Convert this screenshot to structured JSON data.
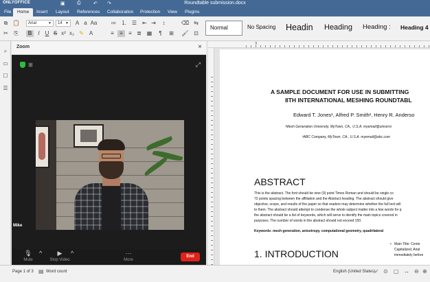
{
  "titlebar": {
    "app_name": "ONLYOFFICE",
    "document_title": "Roundtable submission.docx"
  },
  "menu": {
    "tabs": [
      "File",
      "Home",
      "Insert",
      "Layout",
      "References",
      "Collaboration",
      "Protection",
      "View",
      "Plugins"
    ],
    "active_tab": "Home"
  },
  "toolbar": {
    "font_name": "Arial",
    "font_size": "14",
    "styles": [
      "Normal",
      "No Spacing",
      "Headin",
      "Heading",
      "Heading :",
      "Heading 4"
    ]
  },
  "zoom": {
    "panel_title": "Zoom",
    "participant_name": "Mike",
    "controls": {
      "mute_label": "Mute",
      "stop_video_label": "Stop Video",
      "more_label": "More",
      "end_label": "End"
    }
  },
  "document": {
    "title_line1": "A SAMPLE DOCUMENT FOR USE IN SUBMITTING",
    "title_line2": "8TH INTERNATIONAL MESHING ROUNDTABL",
    "authors": "Edward T. Jones¹, Alfred P. Smith², Henry R. Anderso",
    "affiliation1": "¹Mesh Generation University, MyTown, CA., U.S.A. myemail@universi",
    "affiliation2": "²ABC Company, MyTown, CA., U.S.A. myemail@abc.com",
    "abstract_heading": "ABSTRACT",
    "abstract_lines": [
      "This is the abstract.  The font should be nine (9) point Times Roman and should be single co",
      "72 points spacing between the affiliation and the Abstract heading.  The abstract should give",
      "objective, scope, and results of the paper so that readers may determine whether the full text will",
      "to them. The abstract should attempt to condense the whole subject matter into a few words for q",
      "the abstract should be a list of keywords, which will serve to identify the main topics covered in",
      "purposes.  The number of words in the abstract should not exceed 150."
    ],
    "keywords": "Keywords: mesh generation, anisotropy, computational geometry, quadrilateral",
    "intro_heading": "1. INTRODUCTION",
    "side_note_lines": [
      "Main   Title:   Cente",
      "Capitalized,  Arial  ",
      "immediately before"
    ]
  },
  "statusbar": {
    "page_info": "Page 1 of 3",
    "word_count": "Word count",
    "language": "English (United States)"
  }
}
